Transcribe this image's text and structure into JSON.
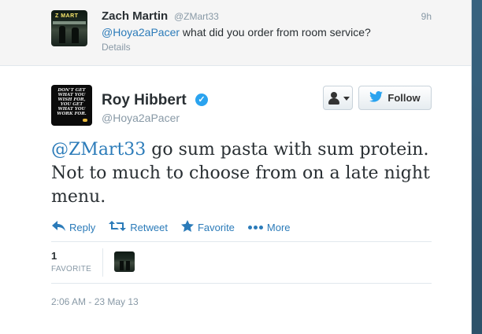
{
  "parent_tweet": {
    "name": "Zach Martin",
    "handle": "@ZMart33",
    "time": "9h",
    "mention": "@Hoya2aPacer",
    "text": " what did you order from room service?",
    "details_label": "Details",
    "avatar_label": "Z MART"
  },
  "tweet": {
    "name": "Roy Hibbert",
    "handle": "@Hoya2aPacer",
    "avatar_text": "DON'T GET WHAT YOU WISH FOR, YOU GET WHAT YOU WORK FOR.",
    "mention": "@ZMart33",
    "text": " go sum pasta with sum protein. Not to much to choose from on a late night menu.",
    "follow_label": "Follow",
    "timestamp": "2:06 AM - 23 May 13"
  },
  "actions": {
    "reply": "Reply",
    "retweet": "Retweet",
    "favorite": "Favorite",
    "more": "More"
  },
  "stats": {
    "favorite_count": "1",
    "favorite_label": "FAVORITE"
  },
  "colors": {
    "link": "#2b7bb9",
    "verified": "#2aa3ef",
    "muted": "#8899a6"
  }
}
